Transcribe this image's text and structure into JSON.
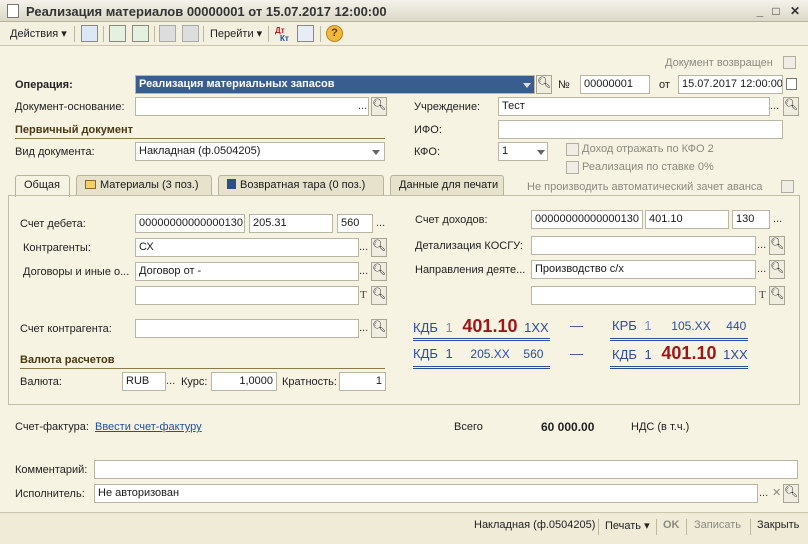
{
  "window": {
    "title": "Реализация материалов 00000001 от 15.07.2017 12:00:00"
  },
  "toolbar": {
    "actions_label": "Действия",
    "goto_label": "Перейти",
    "dtkt_label": "Дт Кт"
  },
  "header": {
    "returned_label": "Документ возвращен",
    "operation_label": "Операция:",
    "operation_value": "Реализация материальных запасов",
    "number_label": "№",
    "number_value": "00000001",
    "date_label": "от",
    "date_value": "15.07.2017 12:00:00",
    "basis_label": "Документ-основание:",
    "basis_value": "",
    "institution_label": "Учреждение:",
    "institution_value": "Тест",
    "primary_doc_section": "Первичный документ",
    "ifo_label": "ИФО:",
    "ifo_value": "",
    "doc_type_label": "Вид документа:",
    "doc_type_value": "Накладная (ф.0504205)",
    "kfo_label": "КФО:",
    "kfo_value": "1",
    "income_kfo2_label": "Доход отражать по КФО 2",
    "vat0_label": "Реализация по ставке 0%"
  },
  "tabs": [
    {
      "label": "Общая"
    },
    {
      "label": "Материалы (3 поз.)"
    },
    {
      "label": "Возвратная тара (0 поз.)"
    },
    {
      "label": "Данные для печати"
    }
  ],
  "no_auto_advance_label": "Не производить автоматический зачет аванса",
  "general": {
    "debit_label": "Счет дебета:",
    "debit_account": "00000000000000130",
    "debit_sub1": "205.31",
    "debit_sub2": "560",
    "counterparty_label": "Контрагенты:",
    "counterparty_value": "СХ",
    "contracts_label": "Договоры и иные о...",
    "contracts_value": "Договор  от -",
    "contracts_extra": "",
    "cp_account_label": "Счет контрагента:",
    "cp_account_value": "",
    "currency_section": "Валюта расчетов",
    "currency_label": "Валюта:",
    "currency_value": "RUB",
    "rate_label": "Курс:",
    "rate_value": "1,0000",
    "multiplicity_label": "Кратность:",
    "multiplicity_value": "1",
    "income_label": "Счет доходов:",
    "income_account": "00000000000000130",
    "income_sub1": "401.10",
    "income_sub2": "130",
    "kosgu_label": "Детализация КОСГУ:",
    "kosgu_value": "",
    "direction_label": "Направления деяте...",
    "direction_value": "Производство с/х",
    "direction_extra": ""
  },
  "correspondence": {
    "row1_left_prefix": "КДБ",
    "row1_left_kfo": "1",
    "row1_left_acc": "401.10",
    "row1_left_suffix": "1XX",
    "row1_right_prefix": "КРБ",
    "row1_right_kfo": "1",
    "row1_right_acc": "105.XX",
    "row1_right_suffix": "440",
    "row2_left_prefix": "КДБ",
    "row2_left_kfo": "1",
    "row2_left_acc": "205.XX",
    "row2_left_suffix": "560",
    "row2_right_prefix": "КДБ",
    "row2_right_kfo": "1",
    "row2_right_acc": "401.10",
    "row2_right_suffix": "1XX",
    "dash": "—"
  },
  "footer": {
    "invoice_label": "Счет-фактура:",
    "invoice_link": "Ввести счет-фактуру",
    "total_label": "Всего",
    "total_value": "60 000.00",
    "vat_label": "НДС (в т.ч.)",
    "comment_label": "Комментарий:",
    "comment_value": "",
    "executor_label": "Исполнитель:",
    "executor_value": "Не авторизован"
  },
  "status_bar": {
    "print_form": "Накладная (ф.0504205)",
    "print_label": "Печать",
    "ok_label": "OK",
    "write_label": "Записать",
    "close_label": "Закрыть"
  }
}
